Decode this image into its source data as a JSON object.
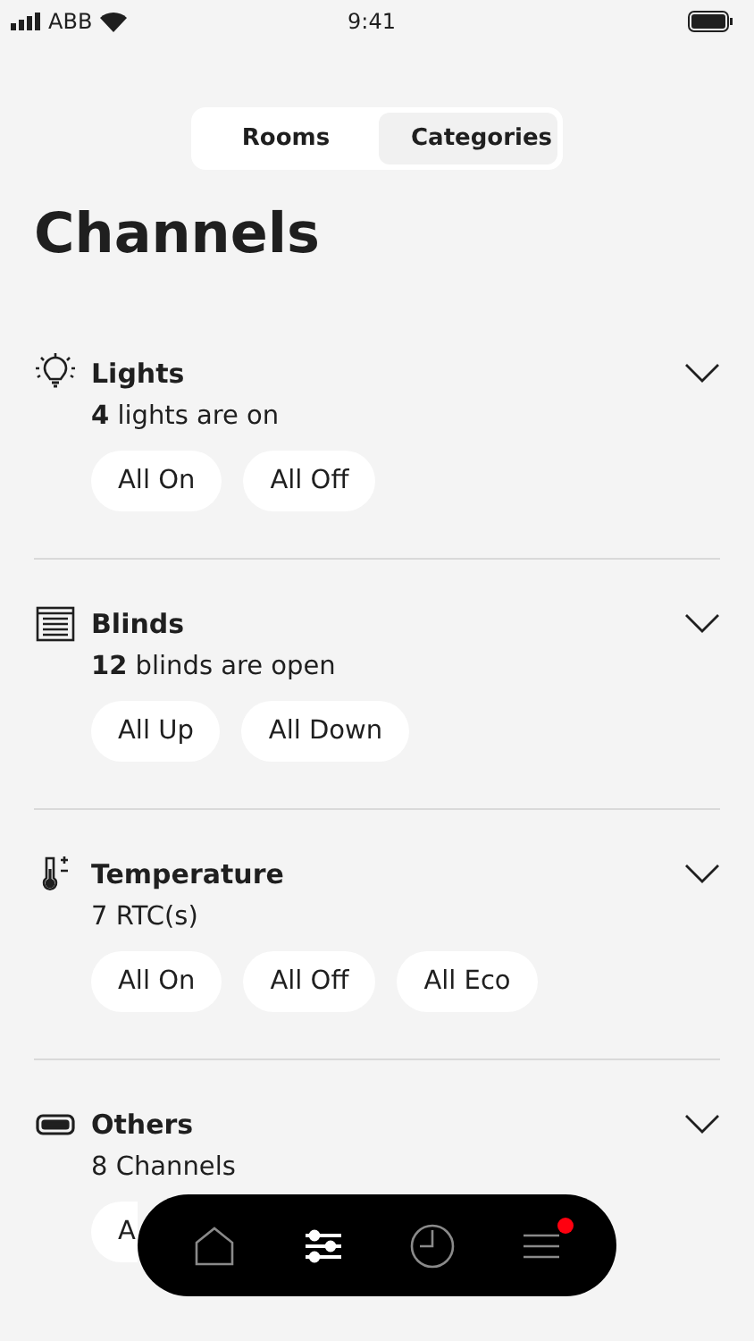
{
  "status_bar": {
    "carrier": "ABB",
    "time": "9:41"
  },
  "segments": [
    {
      "label": "Rooms",
      "selected": false
    },
    {
      "label": "Categories",
      "selected": true
    }
  ],
  "title": "Channels",
  "categories": [
    {
      "kind": "lights",
      "name": "Lights",
      "summary": "**4** lights are on",
      "expanded": false,
      "actions": [
        "All On",
        "All Off"
      ]
    },
    {
      "kind": "blinds",
      "name": "Blinds",
      "summary": "**12** blinds are open",
      "expanded": false,
      "actions": [
        "All Up",
        "All Down"
      ]
    },
    {
      "kind": "temperature",
      "name": "Temperature",
      "summary": "7 RTC(s)",
      "expanded": false,
      "actions": [
        "All On",
        "All Off",
        "All Eco"
      ]
    },
    {
      "kind": "others",
      "name": "Others",
      "summary": "8 Channels",
      "expanded": false,
      "actions": [
        "A"
      ]
    }
  ],
  "nav": [
    {
      "kind": "home",
      "selected": false,
      "badge": false
    },
    {
      "kind": "controls",
      "selected": true,
      "badge": false
    },
    {
      "kind": "clock",
      "selected": false,
      "badge": false
    },
    {
      "kind": "menu",
      "selected": false,
      "badge": true
    }
  ]
}
